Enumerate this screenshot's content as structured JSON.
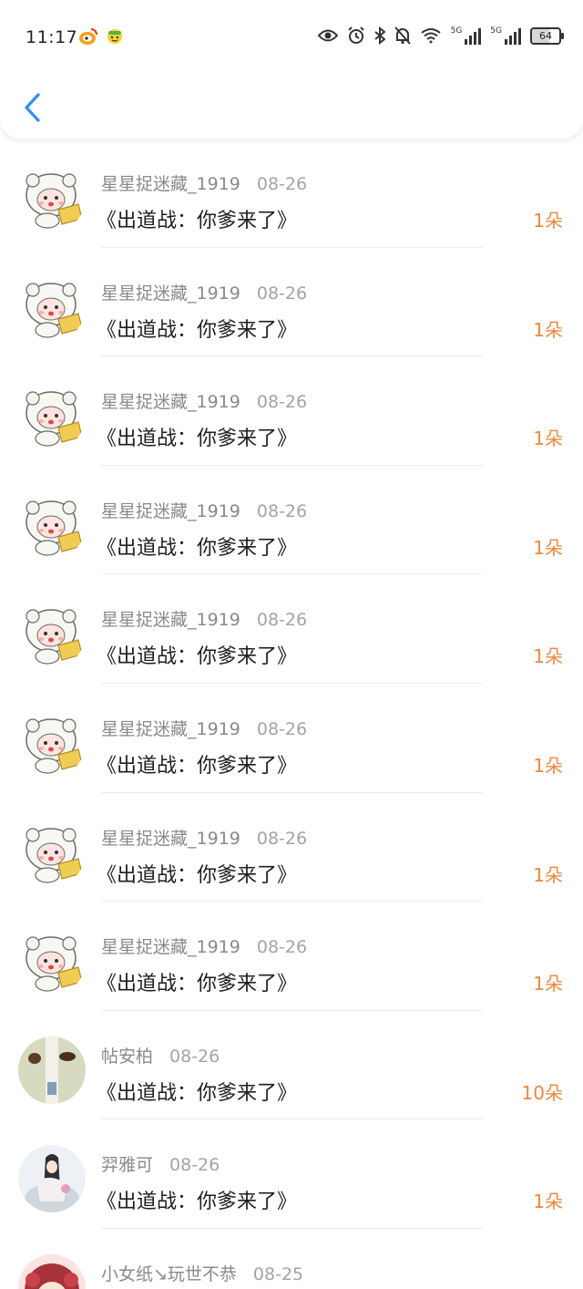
{
  "status": {
    "time": "11:17",
    "battery": "64",
    "net1": "5G",
    "net2": "5G"
  },
  "colors": {
    "accent": "#2f8ff5",
    "count": "#f0873c"
  },
  "header": {
    "back_icon": "chevron-left-icon"
  },
  "rows": [
    {
      "name": "星星捉迷藏_1919",
      "date": "08-26",
      "title": "《出道战：你爹来了》",
      "count": "1朵",
      "avatar": "sheep"
    },
    {
      "name": "星星捉迷藏_1919",
      "date": "08-26",
      "title": "《出道战：你爹来了》",
      "count": "1朵",
      "avatar": "sheep"
    },
    {
      "name": "星星捉迷藏_1919",
      "date": "08-26",
      "title": "《出道战：你爹来了》",
      "count": "1朵",
      "avatar": "sheep"
    },
    {
      "name": "星星捉迷藏_1919",
      "date": "08-26",
      "title": "《出道战：你爹来了》",
      "count": "1朵",
      "avatar": "sheep"
    },
    {
      "name": "星星捉迷藏_1919",
      "date": "08-26",
      "title": "《出道战：你爹来了》",
      "count": "1朵",
      "avatar": "sheep"
    },
    {
      "name": "星星捉迷藏_1919",
      "date": "08-26",
      "title": "《出道战：你爹来了》",
      "count": "1朵",
      "avatar": "sheep"
    },
    {
      "name": "星星捉迷藏_1919",
      "date": "08-26",
      "title": "《出道战：你爹来了》",
      "count": "1朵",
      "avatar": "sheep"
    },
    {
      "name": "星星捉迷藏_1919",
      "date": "08-26",
      "title": "《出道战：你爹来了》",
      "count": "1朵",
      "avatar": "sheep"
    },
    {
      "name": "帖安柏",
      "date": "08-26",
      "title": "《出道战：你爹来了》",
      "count": "10朵",
      "avatar": "dogs"
    },
    {
      "name": "羿雅可",
      "date": "08-26",
      "title": "《出道战：你爹来了》",
      "count": "1朵",
      "avatar": "girl"
    },
    {
      "name": "小女纸↘玩世不恭",
      "date": "08-25",
      "title": "",
      "count": "",
      "avatar": "anime"
    }
  ]
}
